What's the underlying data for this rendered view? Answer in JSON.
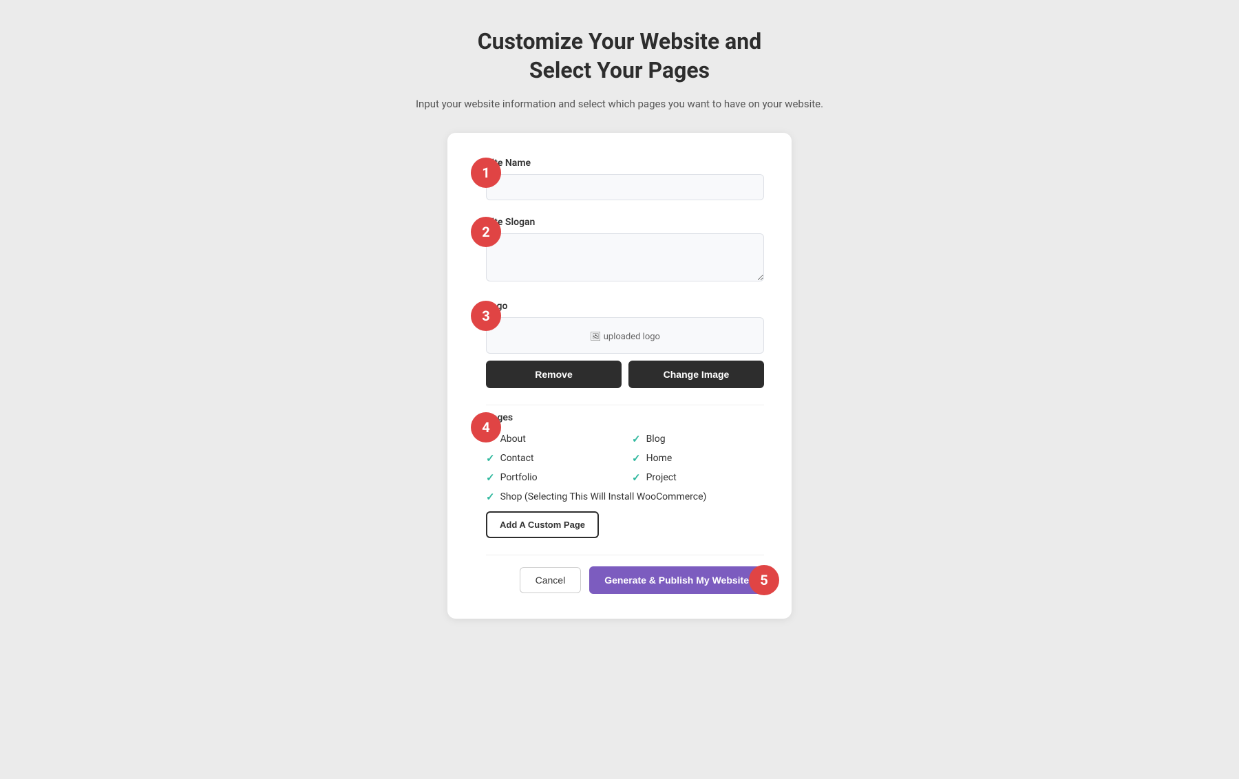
{
  "header": {
    "title_line1": "Customize Your Website and",
    "title_line2": "Select Your Pages",
    "subtitle": "Input your website information and select which pages you want to have on your website."
  },
  "steps": {
    "step1": "1",
    "step2": "2",
    "step3": "3",
    "step4": "4",
    "step5": "5"
  },
  "form": {
    "site_name_label": "Site Name",
    "site_name_placeholder": "",
    "site_slogan_label": "Site Slogan",
    "site_slogan_placeholder": "",
    "logo_label": "Logo",
    "logo_preview_text": "uploaded logo",
    "remove_button": "Remove",
    "change_image_button": "Change Image",
    "pages_label": "Pages",
    "pages": [
      {
        "name": "About",
        "checked": true
      },
      {
        "name": "Blog",
        "checked": true
      },
      {
        "name": "Contact",
        "checked": true
      },
      {
        "name": "Home",
        "checked": true
      },
      {
        "name": "Portfolio",
        "checked": true
      },
      {
        "name": "Project",
        "checked": true
      }
    ],
    "shop_page": "Shop (Selecting This Will Install WooCommerce)",
    "shop_checked": true,
    "add_custom_page_button": "Add A Custom Page",
    "cancel_button": "Cancel",
    "publish_button": "Generate & Publish My Website"
  }
}
